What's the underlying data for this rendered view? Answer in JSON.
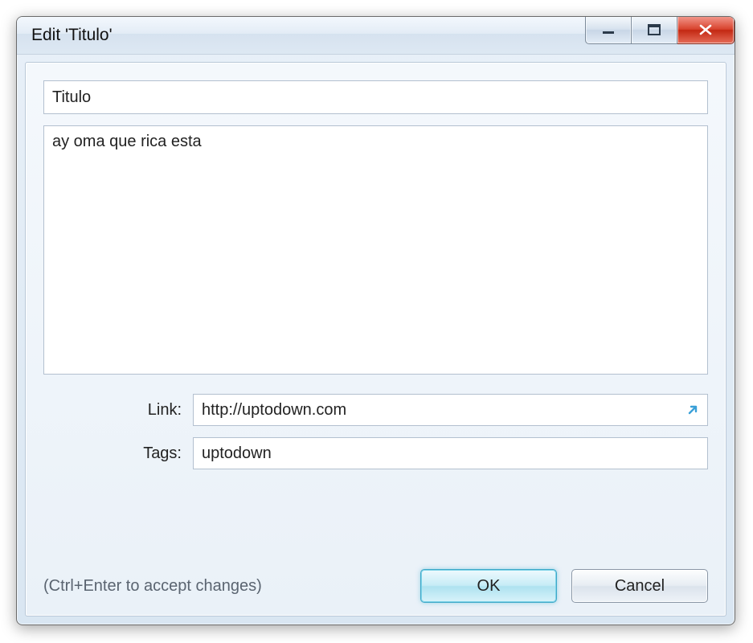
{
  "window": {
    "title": "Edit 'Titulo'"
  },
  "fields": {
    "title_value": "Titulo",
    "body_value": "ay oma que rica esta",
    "link_label": "Link:",
    "link_value": "http://uptodown.com",
    "tags_label": "Tags:",
    "tags_value": "uptodown"
  },
  "footer": {
    "hint": "(Ctrl+Enter to accept changes)",
    "ok_label": "OK",
    "cancel_label": "Cancel"
  }
}
